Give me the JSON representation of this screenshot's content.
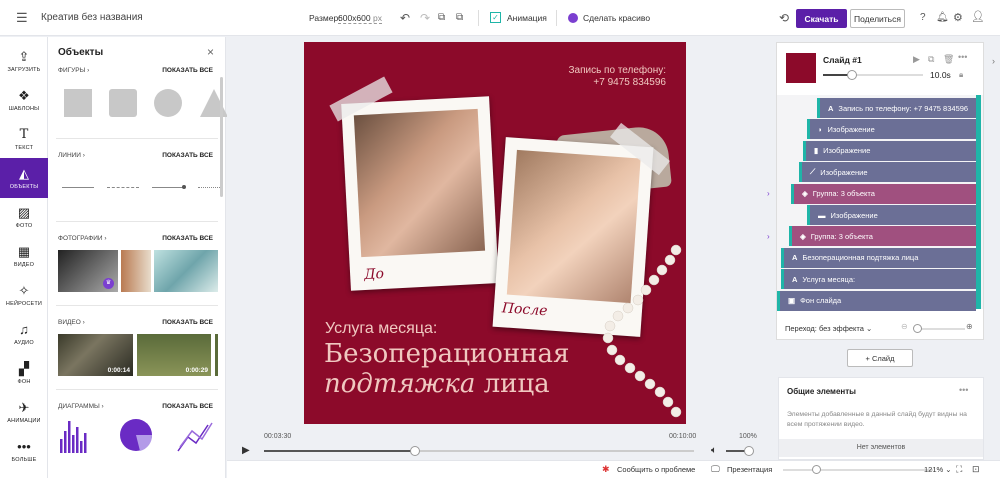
{
  "header": {
    "title": "Креатив без названия",
    "size_label": "Размер:",
    "size_value": "600x600",
    "size_unit": "px",
    "animation_label": "Анимация",
    "beautify_label": "Сделать красиво",
    "download_label": "Скачать",
    "share_label": "Поделиться"
  },
  "nav": {
    "upload": "ЗАГРУЗИТЬ",
    "templates": "ШАБЛОНЫ",
    "text": "ТЕКСТ",
    "objects": "ОБЪЕКТЫ",
    "photo": "ФОТО",
    "video": "ВИДЕО",
    "ai": "НЕЙРОСЕТИ",
    "audio": "АУДИО",
    "background": "ФОН",
    "animation": "АНИМАЦИИ",
    "more": "БОЛЬШЕ"
  },
  "panel": {
    "title": "Объекты",
    "show_all": "ПОКАЗАТЬ ВСЕ",
    "shapes": "ФИГУРЫ",
    "lines": "ЛИНИИ",
    "photos": "ФОТОГРАФИИ",
    "video": "ВИДЕО",
    "charts": "ДИАГРАММЫ",
    "video_durations": [
      "0:00:14",
      "0:00:29"
    ]
  },
  "slide": {
    "phone_line1": "Запись по телефону:",
    "phone_line2": "+7 9475 834596",
    "caption_before": "До",
    "caption_after": "После",
    "service": "Услуга месяца:",
    "headline_line1": "Безоперационная",
    "headline_italic": "подтяжка",
    "headline_rest": "лица"
  },
  "timeline": {
    "current": "00:03:30",
    "total": "00:10:00",
    "volume": "100%",
    "volume_level": 0.9,
    "progress": 0.35
  },
  "slide_panel": {
    "name": "Слайд #1",
    "duration": "10.0s",
    "transition": "Переход: без эффекта",
    "add_slide": "+ Слайд",
    "color": "#8c0a2a"
  },
  "layers": [
    {
      "icon": "A",
      "label": "Запись по телефону: +7 9475 834596",
      "type": "text"
    },
    {
      "icon": "◗",
      "label": "Изображение",
      "type": "image"
    },
    {
      "icon": "▮",
      "label": "Изображение",
      "type": "image"
    },
    {
      "icon": "⟋",
      "label": "Изображение",
      "type": "image"
    },
    {
      "icon": "◈",
      "label": "Группа: 3 объекта",
      "type": "group"
    },
    {
      "icon": "▬",
      "label": "Изображение",
      "type": "image"
    },
    {
      "icon": "◈",
      "label": "Группа: 3 объекта",
      "type": "group"
    },
    {
      "icon": "A",
      "label": "Безоперационная подтяжка лица",
      "type": "text"
    },
    {
      "icon": "A",
      "label": "Услуга месяца:",
      "type": "text"
    },
    {
      "icon": "▣",
      "label": "Фон слайда",
      "type": "background"
    }
  ],
  "common": {
    "title": "Общие элементы",
    "desc": "Элементы добавленные в данный слайд будут видны на всем протяжении видео.",
    "empty": "Нет элементов"
  },
  "bottom": {
    "report": "Сообщить о проблеме",
    "present": "Презентация",
    "zoom": "121%"
  },
  "colors": {
    "accent": "#5b1fa8",
    "slide_bg": "#8c0a2a",
    "layer": "#6b6f96",
    "group": "#a0507f",
    "teal": "#1fb5a8"
  }
}
